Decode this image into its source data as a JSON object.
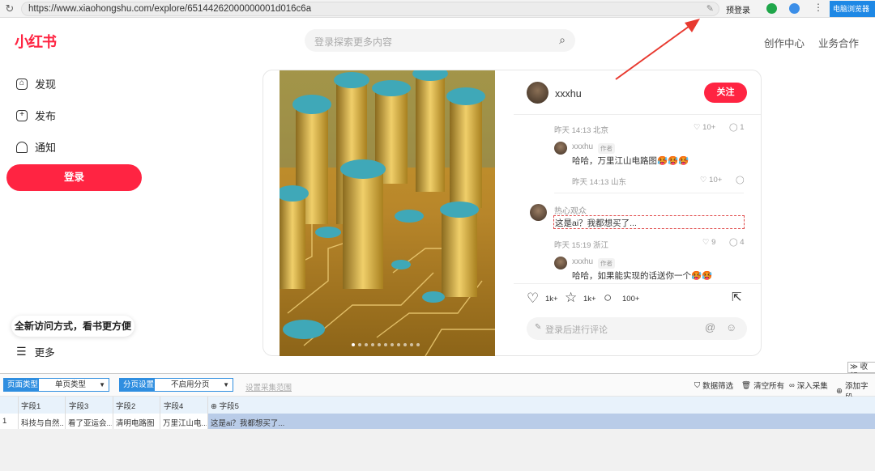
{
  "browser": {
    "url": "https://www.xiaohongshu.com/explore/65144262000000001d016c6a",
    "prelogin": "预登录",
    "browser_button": "电脑浏览器"
  },
  "header": {
    "logo": "小红书",
    "search_placeholder": "登录探索更多内容",
    "nav": [
      "创作中心",
      "业务合作"
    ]
  },
  "sidebar": {
    "items": [
      {
        "label": "发现",
        "icon": "home-icon"
      },
      {
        "label": "发布",
        "icon": "plus-square-icon"
      },
      {
        "label": "通知",
        "icon": "bell-icon"
      }
    ],
    "login": "登录",
    "tip": "全新访问方式，看书更方便",
    "more": "更多"
  },
  "note": {
    "author": "xxxhu",
    "follow": "关注",
    "comments": [
      {
        "meta": "昨天 14:13 北京",
        "likes": "10+",
        "replies": "1"
      },
      {
        "name": "xxxhu",
        "tag": "作者",
        "text": "哈哈，万里江山电路图🥵🥵🥵",
        "meta": "昨天 14:13 山东",
        "likes": "10+"
      },
      {
        "name": "热心观众",
        "text": "这是ai？我都想买了...",
        "meta": "昨天 15:19 浙江",
        "likes": "9",
        "replies": "4"
      },
      {
        "name": "xxxhu",
        "tag": "作者",
        "text": "哈哈，如果能实现的话送你一个🥵🥵"
      }
    ],
    "likes": "1k+",
    "collects": "1k+",
    "comment_count": "100+",
    "comment_placeholder": "登录后进行评论"
  },
  "collector": {
    "collapse": "收起",
    "page_type_label": "页面类型",
    "page_type_value": "单页类型",
    "paging_label": "分页设置",
    "paging_value": "不启用分页",
    "range_link": "设置采集范围",
    "tools": [
      "数据筛选",
      "清空所有",
      "深入采集",
      "添加字段"
    ],
    "columns": [
      "字段1",
      "字段3",
      "字段2",
      "字段4",
      "字段5"
    ],
    "rows": [
      {
        "index": "1",
        "cells": [
          "科技与自然...",
          "看了亚运会...",
          "清明电路图",
          "万里江山电...",
          "这是ai？我都想买了..."
        ]
      }
    ]
  },
  "colors": {
    "brand": "#ff2442",
    "accent": "#2f8ee0",
    "annotation_arrow": "#e8392f"
  }
}
